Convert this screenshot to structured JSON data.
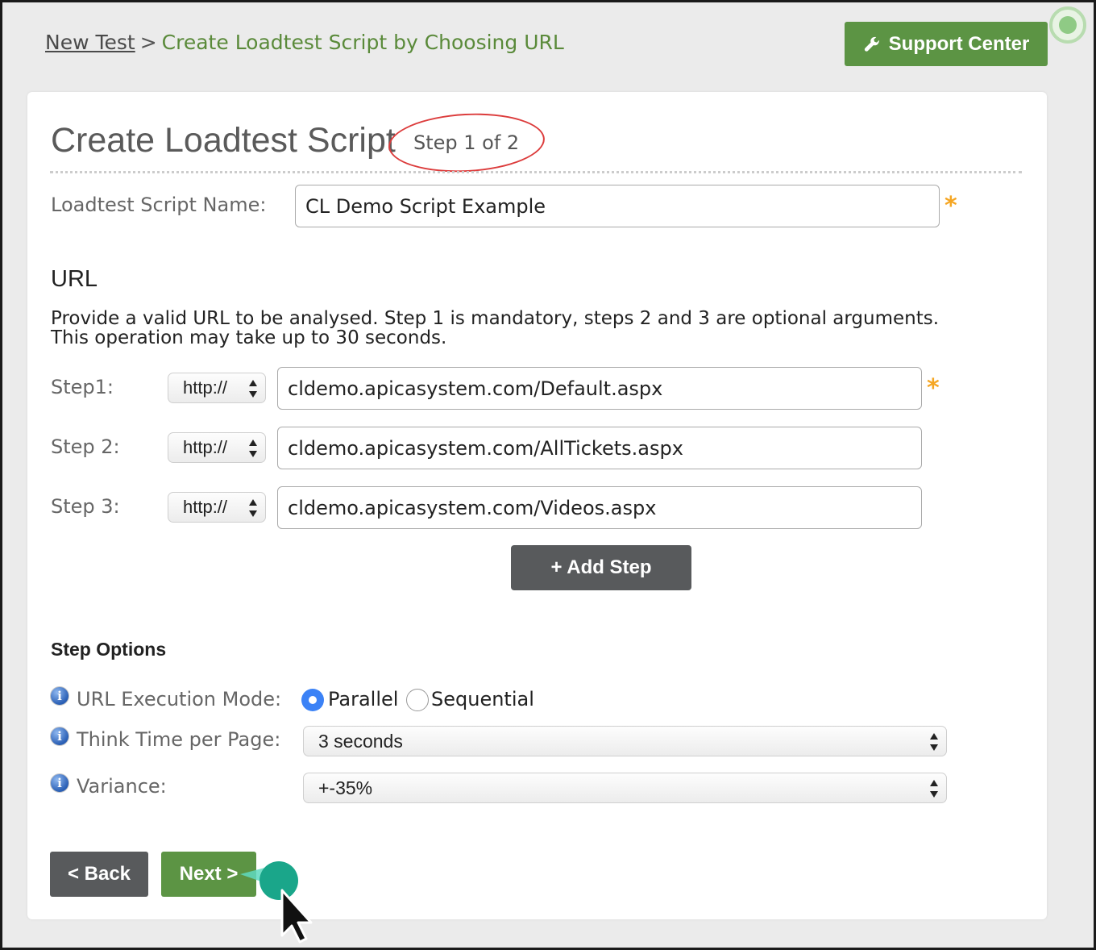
{
  "breadcrumb": {
    "parent": "New Test",
    "separator": ">",
    "current": "Create Loadtest Script by Choosing URL"
  },
  "header": {
    "support_label": "Support Center",
    "support_icon": "wrench-icon"
  },
  "page": {
    "title": "Create Loadtest Script",
    "step_indicator": "Step 1 of 2"
  },
  "script_name": {
    "label": "Loadtest Script Name:",
    "value": "CL Demo Script Example",
    "required_mark": "*"
  },
  "url_section": {
    "heading": "URL",
    "description_line1": "Provide a valid URL to be analysed. Step 1 is mandatory, steps 2 and 3 are optional arguments.",
    "description_line2": "This operation may take up to 30 seconds.",
    "steps": [
      {
        "label": "Step1:",
        "protocol": "http://",
        "url": "cldemo.apicasystem.com/Default.aspx",
        "required_mark": "*"
      },
      {
        "label": "Step 2:",
        "protocol": "http://",
        "url": "cldemo.apicasystem.com/AllTickets.aspx"
      },
      {
        "label": "Step 3:",
        "protocol": "http://",
        "url": "cldemo.apicasystem.com/Videos.aspx"
      }
    ],
    "add_step_label": "+ Add Step"
  },
  "step_options": {
    "heading": "Step Options",
    "execution_mode": {
      "label": "URL Execution Mode:",
      "options": [
        "Parallel",
        "Sequential"
      ],
      "selected": "Parallel"
    },
    "think_time": {
      "label": "Think Time per Page:",
      "value": "3 seconds"
    },
    "variance": {
      "label": "Variance:",
      "value": "+-35%"
    },
    "info_glyph": "i"
  },
  "footer": {
    "back_label": "< Back",
    "next_label": "Next >"
  },
  "colors": {
    "brand_green": "#5c9444",
    "dark_button": "#585a5c",
    "required_asterisk": "#f5a623",
    "step_circle": "#dc3c3c",
    "radio_selected": "#3b82f6",
    "click_marker": "#1aa68a"
  }
}
